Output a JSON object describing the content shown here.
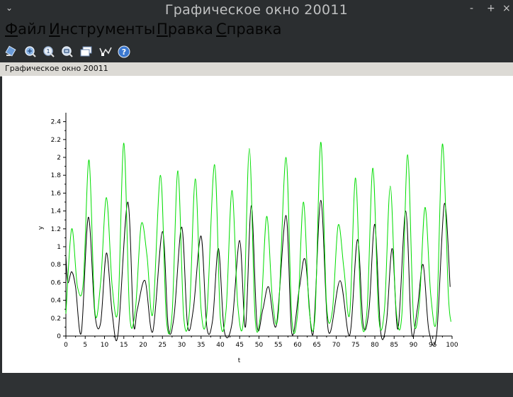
{
  "window": {
    "title": "Графическое окно 20011",
    "controls": [
      "-",
      "+",
      "×"
    ]
  },
  "menu": {
    "file": {
      "mnemonic": "Ф",
      "rest": "айл"
    },
    "tools": {
      "mnemonic": "И",
      "rest": "нструменты"
    },
    "edit": {
      "mnemonic": "П",
      "rest": "равка"
    },
    "help": {
      "mnemonic": "С",
      "rest": "правка"
    }
  },
  "toolbar": [
    "rotate-icon",
    "zoom-icon",
    "unzoom-icon",
    "zoom-fit-icon",
    "datatip-icon",
    "curve-edit-icon",
    "help-icon"
  ],
  "infobar": {
    "text": "Графическое окно 20011"
  },
  "colors": {
    "black_series": "#000000",
    "green_series": "#00dd00"
  },
  "chart_data": {
    "type": "line",
    "xlabel": "t",
    "ylabel": "y",
    "xlim": [
      0,
      100
    ],
    "ylim": [
      0,
      2.5
    ],
    "xticks": [
      "0",
      "5",
      "10",
      "15",
      "20",
      "25",
      "30",
      "35",
      "40",
      "45",
      "50",
      "55",
      "60",
      "65",
      "70",
      "75",
      "80",
      "85",
      "90",
      "95",
      "100"
    ],
    "yticks": [
      "0",
      "0.2",
      "0.4",
      "0.6",
      "0.8",
      "1",
      "1.2",
      "1.4",
      "1.6",
      "1.8",
      "2",
      "2.2",
      "2.4"
    ],
    "grid": false,
    "series": [
      {
        "color": "#000000",
        "points": [
          [
            0,
            0.9
          ],
          [
            0.5,
            0.6
          ],
          [
            1.5,
            0.72
          ],
          [
            2.5,
            0.55
          ],
          [
            4,
            0.04
          ],
          [
            5.8,
            1.33
          ],
          [
            7.5,
            0.25
          ],
          [
            9,
            0.15
          ],
          [
            10.5,
            0.93
          ],
          [
            12,
            0.25
          ],
          [
            13.5,
            0.02
          ],
          [
            16,
            1.5
          ],
          [
            17.5,
            0.15
          ],
          [
            18.5,
            0.3
          ],
          [
            20.5,
            0.62
          ],
          [
            22.5,
            0.05
          ],
          [
            25,
            1.17
          ],
          [
            26.5,
            0.1
          ],
          [
            28,
            0.22
          ],
          [
            30,
            1.22
          ],
          [
            31.5,
            0.12
          ],
          [
            33,
            0.3
          ],
          [
            35,
            1.12
          ],
          [
            36.5,
            0.1
          ],
          [
            38,
            0.18
          ],
          [
            39.5,
            0.98
          ],
          [
            41,
            0.06
          ],
          [
            43,
            0.14
          ],
          [
            45,
            1.07
          ],
          [
            46.5,
            0.1
          ],
          [
            48,
            1.46
          ],
          [
            49.5,
            0.12
          ],
          [
            51,
            0.3
          ],
          [
            52.5,
            0.55
          ],
          [
            54.5,
            0.12
          ],
          [
            57,
            1.35
          ],
          [
            58.5,
            0.03
          ],
          [
            60.5,
            0.55
          ],
          [
            62,
            0.85
          ],
          [
            64,
            0.02
          ],
          [
            66,
            1.52
          ],
          [
            68,
            0.05
          ],
          [
            71,
            0.62
          ],
          [
            73.5,
            0.01
          ],
          [
            75.5,
            1.08
          ],
          [
            77,
            0.12
          ],
          [
            78.5,
            0.3
          ],
          [
            80,
            1.25
          ],
          [
            81.5,
            0.05
          ],
          [
            83,
            0.15
          ],
          [
            84.5,
            0.98
          ],
          [
            86,
            0.08
          ],
          [
            88,
            1.4
          ],
          [
            89.5,
            0.05
          ],
          [
            91,
            0.3
          ],
          [
            92.5,
            0.8
          ],
          [
            94,
            0.06
          ],
          [
            96,
            0.02
          ],
          [
            98,
            1.48
          ],
          [
            99.5,
            0.55
          ]
        ]
      },
      {
        "color": "#00dd00",
        "points": [
          [
            0,
            0.25
          ],
          [
            1.5,
            1.2
          ],
          [
            3,
            0.55
          ],
          [
            4.5,
            0.6
          ],
          [
            6,
            1.97
          ],
          [
            7.5,
            0.28
          ],
          [
            9,
            0.6
          ],
          [
            10.5,
            1.55
          ],
          [
            12,
            0.55
          ],
          [
            13.5,
            0.32
          ],
          [
            15,
            2.16
          ],
          [
            16.5,
            0.25
          ],
          [
            18,
            0.3
          ],
          [
            19.5,
            1.25
          ],
          [
            21,
            0.9
          ],
          [
            22.5,
            0.25
          ],
          [
            24.5,
            1.8
          ],
          [
            26,
            0.2
          ],
          [
            27.5,
            0.25
          ],
          [
            29,
            1.85
          ],
          [
            30.5,
            0.22
          ],
          [
            32,
            0.28
          ],
          [
            33.5,
            1.76
          ],
          [
            35,
            0.3
          ],
          [
            36.5,
            0.25
          ],
          [
            38.5,
            1.92
          ],
          [
            40,
            0.2
          ],
          [
            41.5,
            0.3
          ],
          [
            43,
            1.63
          ],
          [
            44.5,
            0.35
          ],
          [
            46,
            0.2
          ],
          [
            47.5,
            2.1
          ],
          [
            49,
            0.2
          ],
          [
            50.5,
            0.28
          ],
          [
            52,
            1.34
          ],
          [
            53.5,
            0.4
          ],
          [
            55,
            0.25
          ],
          [
            57,
            2.0
          ],
          [
            58.5,
            0.2
          ],
          [
            60,
            0.25
          ],
          [
            61.5,
            1.5
          ],
          [
            63,
            0.3
          ],
          [
            64.5,
            0.22
          ],
          [
            66,
            2.17
          ],
          [
            67.5,
            0.35
          ],
          [
            69,
            0.28
          ],
          [
            70.5,
            1.24
          ],
          [
            72,
            0.75
          ],
          [
            73.5,
            0.25
          ],
          [
            75,
            1.77
          ],
          [
            76.5,
            0.2
          ],
          [
            78,
            0.3
          ],
          [
            79.5,
            1.88
          ],
          [
            81,
            0.22
          ],
          [
            82.5,
            0.3
          ],
          [
            84,
            1.68
          ],
          [
            85.5,
            0.3
          ],
          [
            87,
            0.24
          ],
          [
            88.5,
            2.03
          ],
          [
            90,
            0.22
          ],
          [
            91.5,
            0.35
          ],
          [
            93,
            1.44
          ],
          [
            94.5,
            0.45
          ],
          [
            96,
            0.22
          ],
          [
            97.5,
            2.15
          ],
          [
            99,
            0.5
          ],
          [
            99.7,
            0.16
          ]
        ]
      }
    ]
  }
}
